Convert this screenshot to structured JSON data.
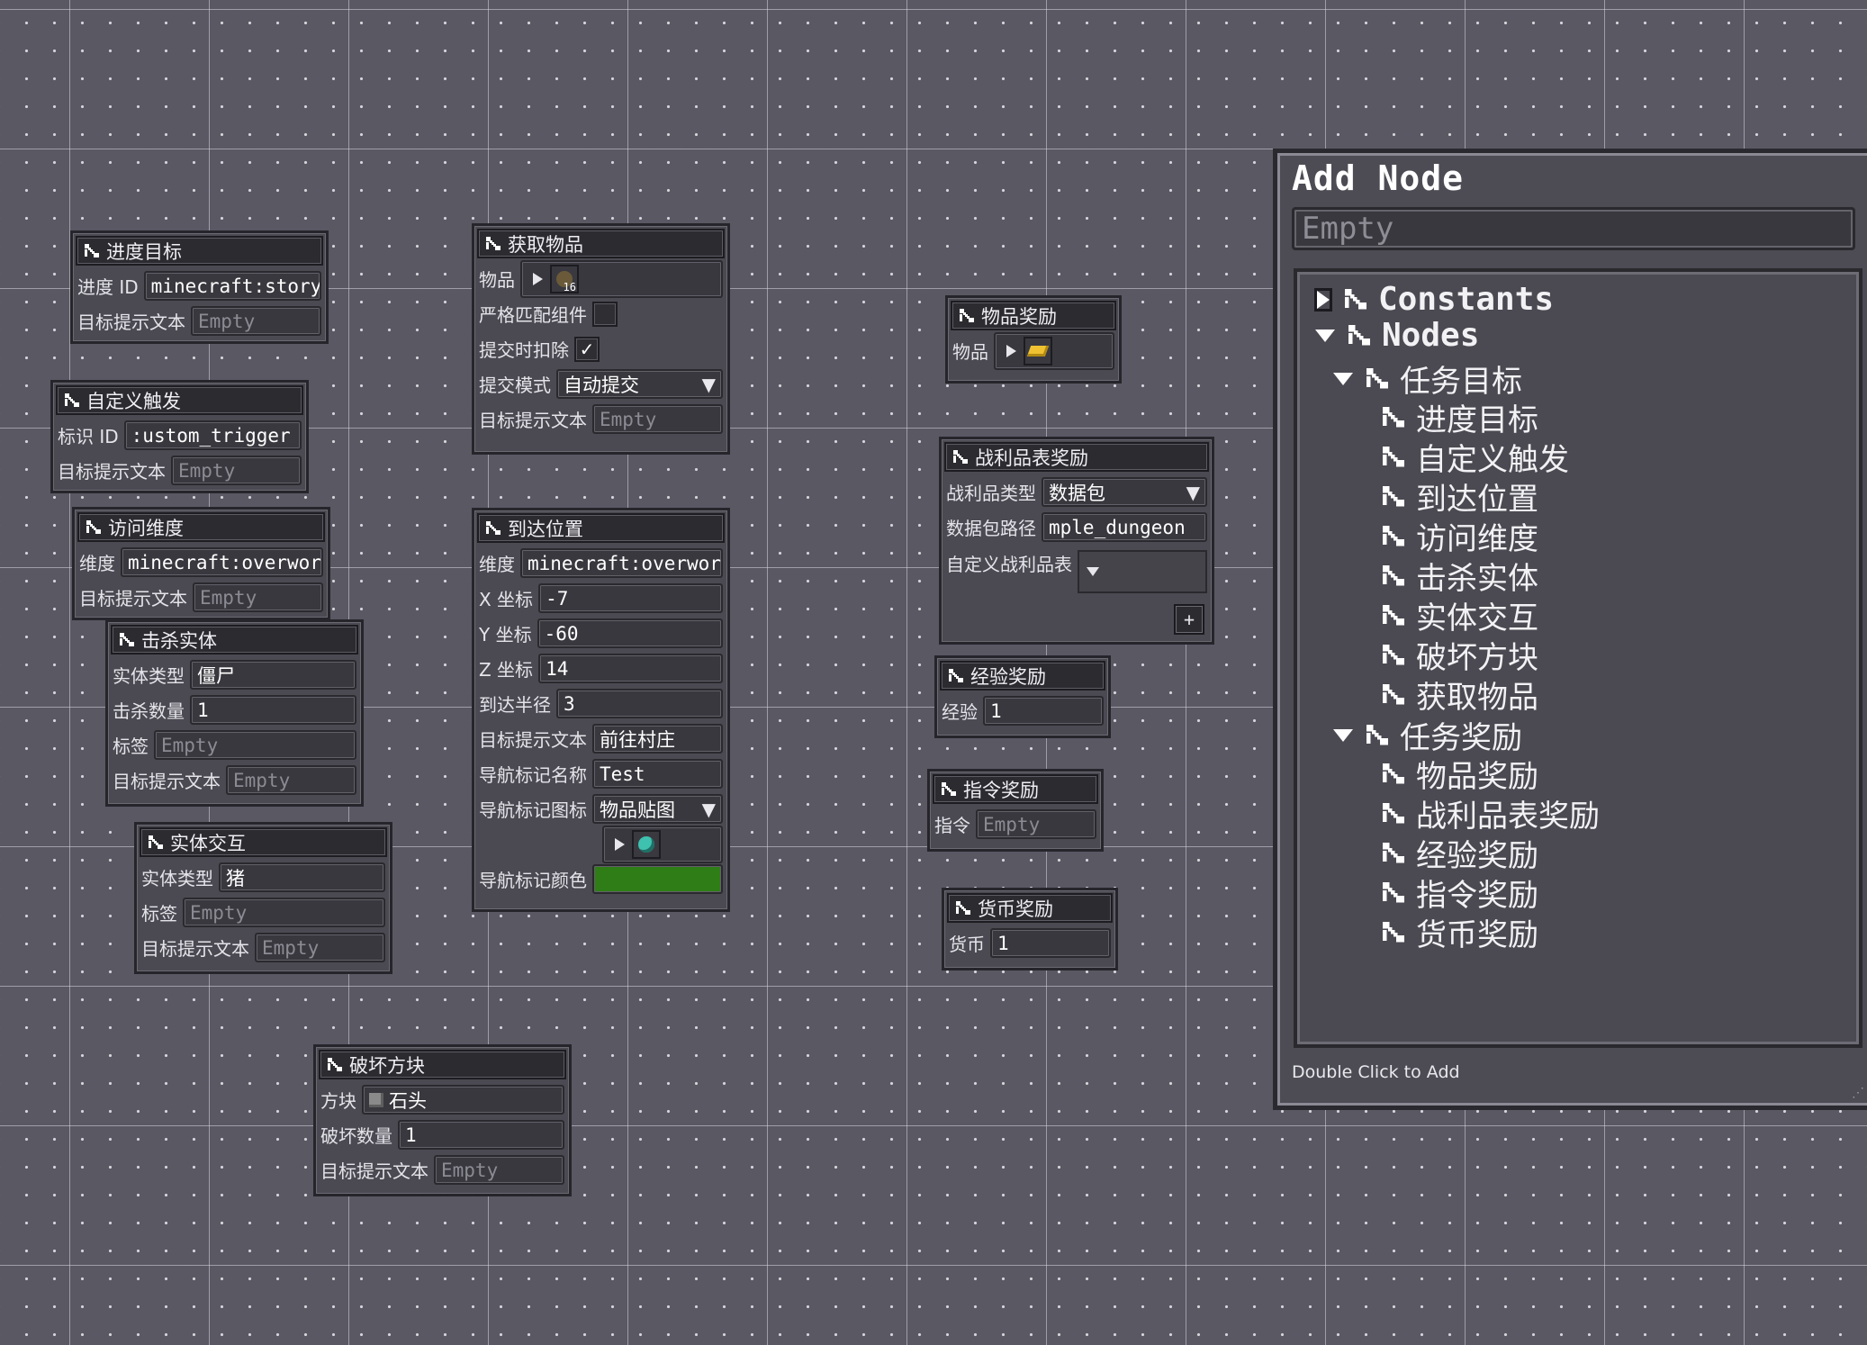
{
  "nodes": {
    "progress": {
      "title": "进度目标",
      "id_label": "进度 ID",
      "id_value": "minecraft:story",
      "text_label": "目标提示文本",
      "text_value": "Empty"
    },
    "custom": {
      "title": "自定义触发",
      "id_label": "标识 ID",
      "id_value": ":ustom_trigger",
      "text_label": "目标提示文本",
      "text_value": "Empty"
    },
    "dimension": {
      "title": "访问维度",
      "dim_label": "维度",
      "dim_value": "minecraft:overwor",
      "text_label": "目标提示文本",
      "text_value": "Empty"
    },
    "kill": {
      "title": "击杀实体",
      "type_label": "实体类型",
      "type_value": "僵尸",
      "count_label": "击杀数量",
      "count_value": "1",
      "tag_label": "标签",
      "tag_value": "Empty",
      "text_label": "目标提示文本",
      "text_value": "Empty"
    },
    "interact": {
      "title": "实体交互",
      "type_label": "实体类型",
      "type_value": "猪",
      "tag_label": "标签",
      "tag_value": "Empty",
      "text_label": "目标提示文本",
      "text_value": "Empty"
    },
    "break": {
      "title": "破坏方块",
      "block_label": "方块",
      "block_value": "石头",
      "count_label": "破坏数量",
      "count_value": "1",
      "text_label": "目标提示文本",
      "text_value": "Empty"
    },
    "obtain": {
      "title": "获取物品",
      "item_label": "物品",
      "item_count": "16",
      "strict_label": "严格匹配组件",
      "strict_checked": false,
      "deduct_label": "提交时扣除",
      "deduct_checked": true,
      "mode_label": "提交模式",
      "mode_value": "自动提交",
      "text_label": "目标提示文本",
      "text_value": "Empty"
    },
    "reach": {
      "title": "到达位置",
      "dim_label": "维度",
      "dim_value": "minecraft:overwor",
      "x_label": "X 坐标",
      "x_value": "-7",
      "y_label": "Y 坐标",
      "y_value": "-60",
      "z_label": "Z 坐标",
      "z_value": "14",
      "radius_label": "到达半径",
      "radius_value": "3",
      "text_label": "目标提示文本",
      "text_value": "前往村庄",
      "marker_name_label": "导航标记名称",
      "marker_name_value": "Test",
      "marker_icon_label": "导航标记图标",
      "marker_icon_value": "物品贴图",
      "marker_color_label": "导航标记颜色",
      "marker_color": "#2f7d16"
    },
    "item_reward": {
      "title": "物品奖励",
      "item_label": "物品"
    },
    "loot_reward": {
      "title": "战利品表奖励",
      "type_label": "战利品类型",
      "type_value": "数据包",
      "path_label": "数据包路径",
      "path_value": "mple_dungeon",
      "custom_label": "自定义战利品表",
      "add_symbol": "+"
    },
    "xp_reward": {
      "title": "经验奖励",
      "xp_label": "经验",
      "xp_value": "1"
    },
    "cmd_reward": {
      "title": "指令奖励",
      "cmd_label": "指令",
      "cmd_value": "Empty"
    },
    "currency_reward": {
      "title": "货币奖励",
      "cur_label": "货币",
      "cur_value": "1"
    }
  },
  "panel": {
    "title": "Add Node",
    "search_placeholder": "Empty",
    "tree": {
      "constants": "Constants",
      "nodes": "Nodes",
      "objectives_group": "任务目标",
      "objectives": [
        "进度目标",
        "自定义触发",
        "到达位置",
        "访问维度",
        "击杀实体",
        "实体交互",
        "破坏方块",
        "获取物品"
      ],
      "rewards_group": "任务奖励",
      "rewards": [
        "物品奖励",
        "战利品表奖励",
        "经验奖励",
        "指令奖励",
        "货币奖励"
      ]
    },
    "hint": "Double Click to Add"
  },
  "icons": {
    "node": "node-link-icon",
    "expand": "triangle-right-icon",
    "collapse": "triangle-down-icon"
  }
}
